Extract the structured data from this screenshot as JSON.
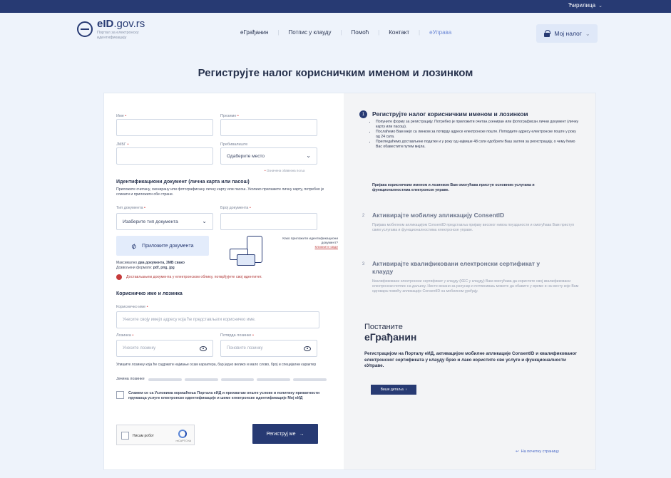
{
  "topbar": {
    "language": "Ћирилица"
  },
  "brand": {
    "name_bold": "eID",
    "name_rest": ".gov.rs",
    "subtitle": "Портал за електронску идентификацију"
  },
  "nav": {
    "items": [
      "еГрађанин",
      "Потпис у клауду",
      "Помоћ",
      "Контакт",
      "еУправа"
    ],
    "account": "Мој налог"
  },
  "page": {
    "title": "Региструјте налог корисничким именом и лозинком"
  },
  "form": {
    "first_name_label": "Име",
    "last_name_label": "Презиме",
    "jmbg_label": "ЈМБГ",
    "residence_label": "Пребивалиште",
    "residence_value": "Одаберите место",
    "required_note": "Означена обавезна поља",
    "doc_heading": "Идентификациони документ (лична карта или пасош)",
    "doc_text": "Приложите очитану, скенирану или фотографисану личну карту или пасош. Уколико прилажете личну карту, потребно је сликати и приложити обе стране.",
    "doc_type_label": "Тип документа",
    "doc_type_value": "Изаберите тип документа",
    "doc_number_label": "Број документа",
    "upload_label": "Приложите документа",
    "help_text": "Како приложити идентификациони документ?",
    "help_link": "Кликните овде",
    "max_text_1": "Максимално",
    "max_text_bold": "два документа, 3MB свако",
    "max_text_2": "Дозвољени формати:",
    "formats_bold": "pdf, png, jpg",
    "alert_text": "Достављањем документа у електронском облику, потврђујете свој идентитет.",
    "cred_heading": "Корисничко име и лозинка",
    "username_label": "Корисничко име",
    "username_placeholder": "Унесите своју имејл адресу која ће представљати корисничко име.",
    "password_label": "Лозинка",
    "password_placeholder": "Унесите лозинку",
    "confirm_label": "Потврда лозинке",
    "confirm_placeholder": "Поновите лозинку",
    "password_hint": "Упишите лозинку која ће садржати најмање осам карактера, бар једно велико и мало слово, број и специјални карактер",
    "strength_label": "Јачина лозинке",
    "terms_text": "Слажем се са Условима коришћења Портала еИД и прихватам опште услове и политику приватности пружаоца услуге електронске идентификације и шеме електронске идентификације Мој еИД",
    "captcha_label": "Нисам робот",
    "captcha_brand": "reCAPTCHA",
    "submit_label": "Региструј ме"
  },
  "steps": [
    {
      "num": "1",
      "title": "Региструјте налог корисничким именом и лозинком",
      "bullets": [
        "Попуните форму за регистрацију. Потребно је приложити очитан,скениран или фотографисан лични документ (личну карту или пасош).",
        "Послаћемо Вам мејл са линком за потврду адресе електронске поште. Потврдите адресу електронске поште у року од 24 сата.",
        "Прегледаћемо достављене податке и у року од највише 48 сати одобрити Ваш захтев за регистрацију, о чему ћемо Вас обавестити путем мејла."
      ],
      "footer": "Пријава корисничким именом и лозинком Вам омогућава приступ основним услугама и функционалностима електронске управе."
    },
    {
      "num": "2",
      "title": "Активирајте мобилну апликацију ConsentID",
      "body": "Пријава мобилном апликацијом ConsentID представља пријаву високог нивоа поузданости и омогућава Вам приступ свим услугама и функционалностима електронске управе."
    },
    {
      "num": "3",
      "title": "Активирајте квалификовани електронски сертификат у клауду",
      "body": "Квалификовани електронски сертификат у клауду (КЕС у клауду) Вам омогућава да користите свој квалификовани електронски потпис на даљину. Нисте везани за рачунар и потписивањ можете да обавите у време и на месту које Вам одговара помоћу апликације ConsentID на мобилном уређају."
    }
  ],
  "promo": {
    "line1": "Постаните",
    "line2": "еГрађанин",
    "text": "Регистрацијом на Порталу еИД, активацијом мобилне апликације ConsentID и квалификованог електронског сертификата у клауду брзо и лако користите све услуге и функционалности еУправе.",
    "button": "Више детаља"
  },
  "home_link": "На почетну страницу"
}
